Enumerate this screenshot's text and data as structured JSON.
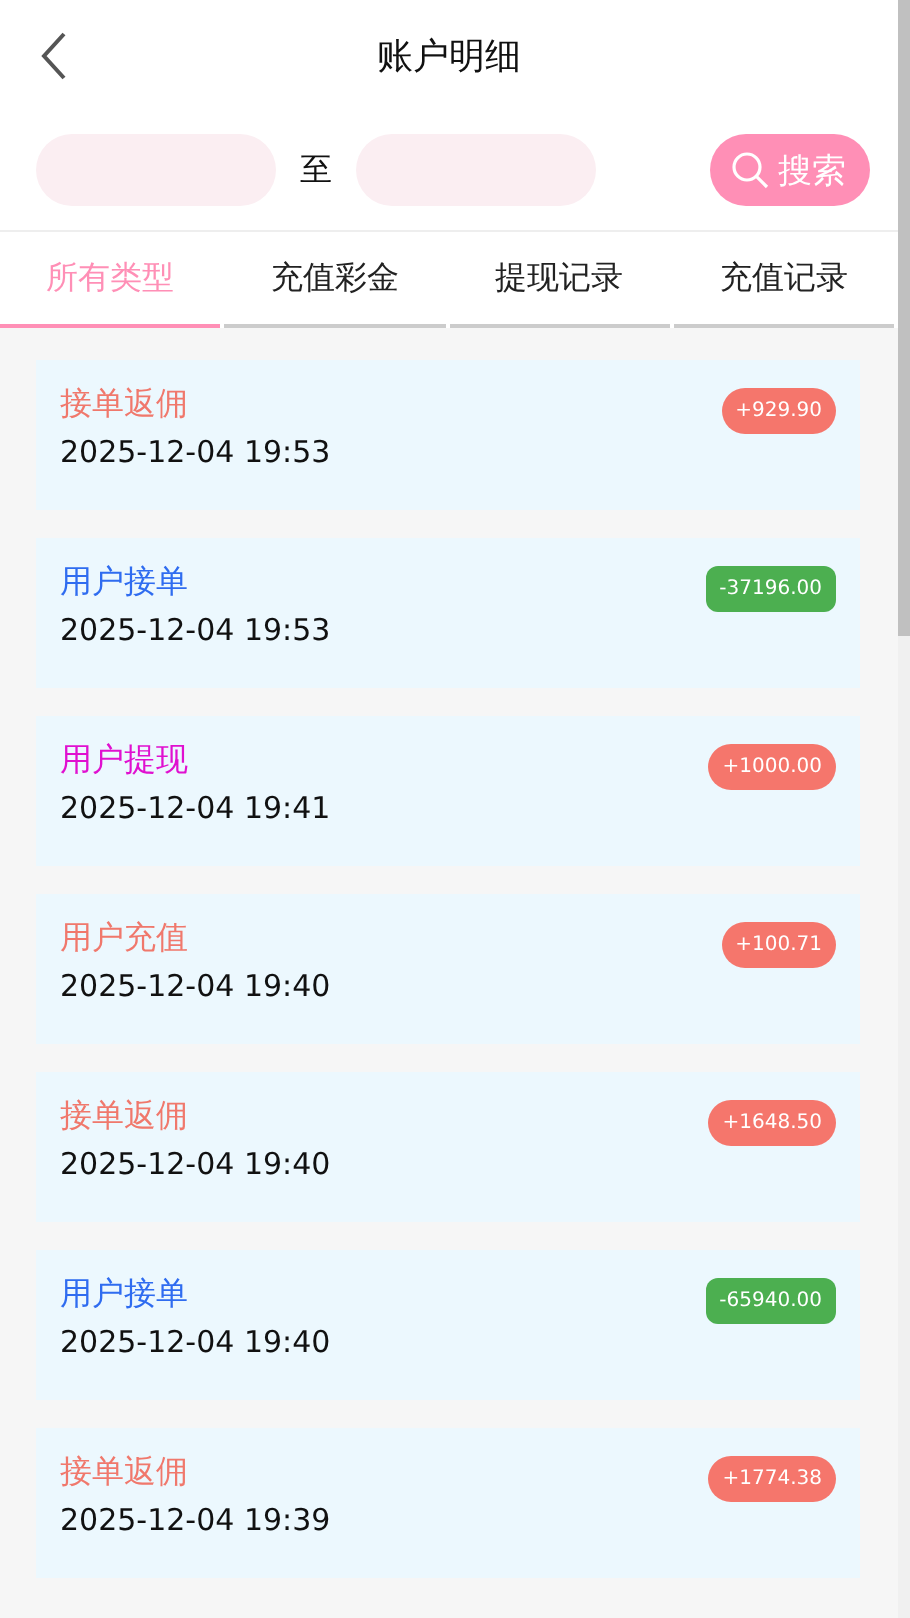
{
  "header": {
    "title": "账户明细"
  },
  "search": {
    "separator": "至",
    "button": "搜索"
  },
  "tabs": [
    {
      "label": "所有类型",
      "selected": true
    },
    {
      "label": "充值彩金",
      "selected": false
    },
    {
      "label": "提现记录",
      "selected": false
    },
    {
      "label": "充值记录",
      "selected": false
    }
  ],
  "records": [
    {
      "type": "接单返佣",
      "color": "#f0786c",
      "time": "2025-12-04 19:53",
      "amount": "+929.90",
      "kind": "income"
    },
    {
      "type": "用户接单",
      "color": "#2f6cf0",
      "time": "2025-12-04 19:53",
      "amount": "-37196.00",
      "kind": "expense"
    },
    {
      "type": "用户提现",
      "color": "#e010d0",
      "time": "2025-12-04 19:41",
      "amount": "+1000.00",
      "kind": "income"
    },
    {
      "type": "用户充值",
      "color": "#f0786c",
      "time": "2025-12-04 19:40",
      "amount": "+100.71",
      "kind": "income"
    },
    {
      "type": "接单返佣",
      "color": "#f0786c",
      "time": "2025-12-04 19:40",
      "amount": "+1648.50",
      "kind": "income"
    },
    {
      "type": "用户接单",
      "color": "#2f6cf0",
      "time": "2025-12-04 19:40",
      "amount": "-65940.00",
      "kind": "expense"
    },
    {
      "type": "接单返佣",
      "color": "#f0786c",
      "time": "2025-12-04 19:39",
      "amount": "+1774.38",
      "kind": "income"
    }
  ]
}
